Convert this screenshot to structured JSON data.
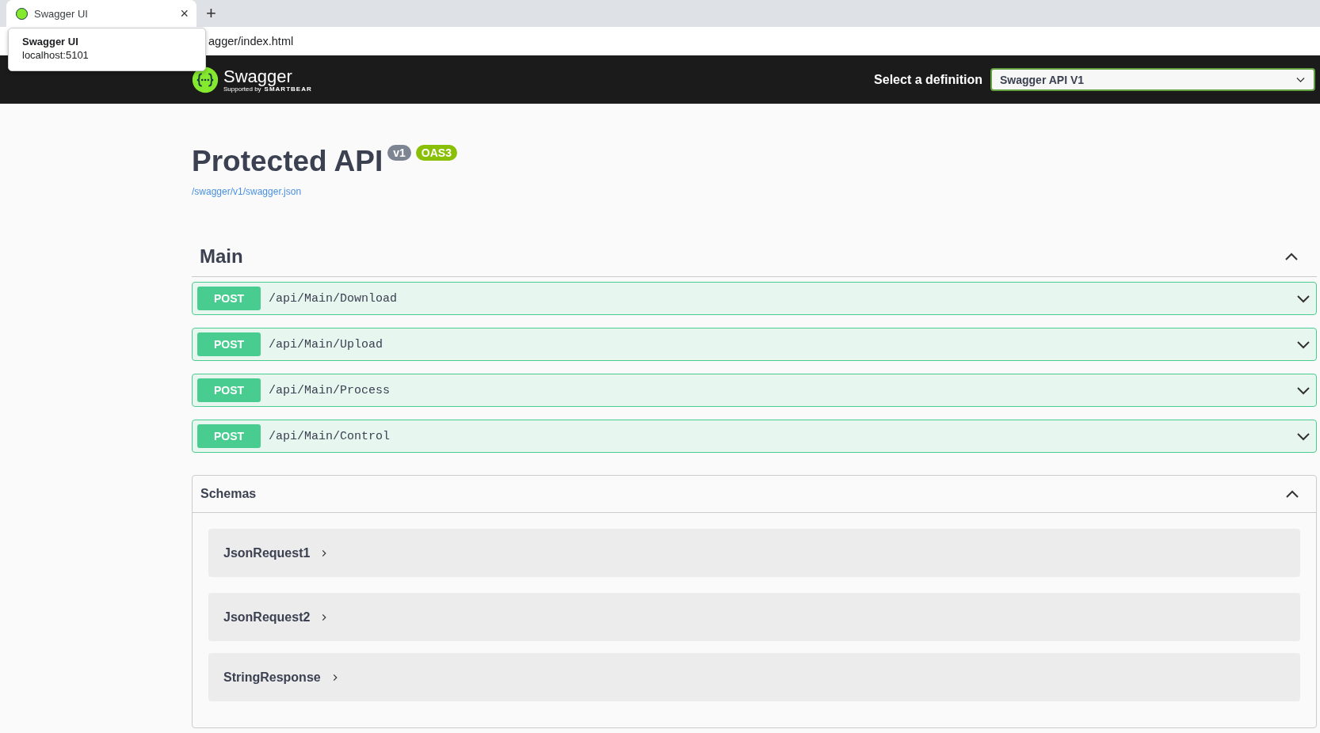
{
  "browser": {
    "tab": {
      "title": "Swagger UI",
      "selected": true
    },
    "close": "×",
    "new_tab": "+",
    "address": "agger/index.html",
    "tooltip": {
      "title": "Swagger UI",
      "subtitle": "localhost:5101"
    }
  },
  "topbar": {
    "logo": "Swagger",
    "supported": "Supported by",
    "brand": "SMARTBEAR",
    "select_label": "Select a definition",
    "select_value": "Swagger API V1"
  },
  "info": {
    "title": "Protected API",
    "version": "v1",
    "spec": "OAS3",
    "link": "/swagger/v1/swagger.json"
  },
  "sections": [
    {
      "name": "Main",
      "expanded": true,
      "operations": [
        {
          "method": "POST",
          "path": "/api/Main/Download",
          "expanded": false
        },
        {
          "method": "POST",
          "path": "/api/Main/Upload",
          "expanded": false
        },
        {
          "method": "POST",
          "path": "/api/Main/Process",
          "expanded": false
        },
        {
          "method": "POST",
          "path": "/api/Main/Control",
          "expanded": false
        }
      ]
    }
  ],
  "schemas": {
    "title": "Schemas",
    "expanded": true,
    "items": [
      {
        "name": "JsonRequest1",
        "expanded": false
      },
      {
        "name": "JsonRequest2",
        "expanded": false
      },
      {
        "name": "StringResponse",
        "expanded": false
      }
    ]
  }
}
